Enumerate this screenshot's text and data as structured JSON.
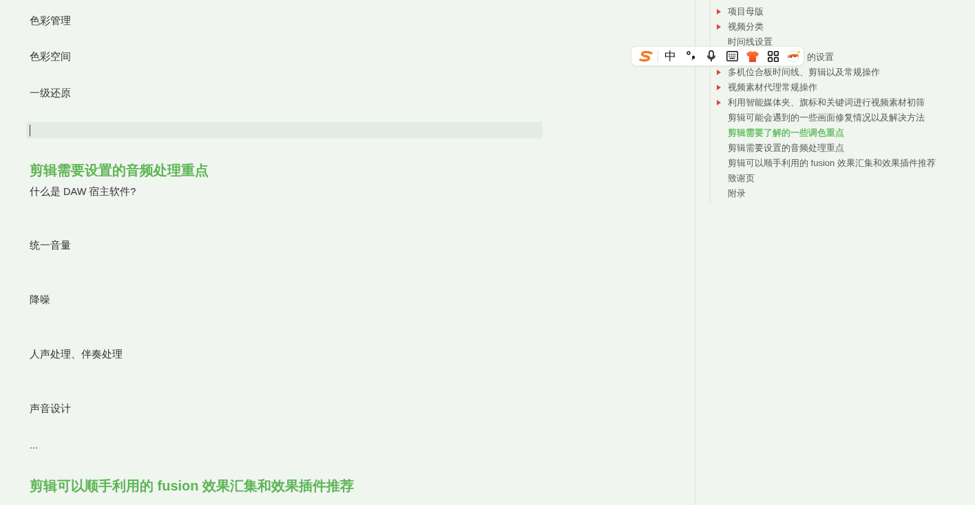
{
  "document": {
    "blocks": [
      {
        "kind": "paragraph",
        "text": "色彩管理"
      },
      {
        "kind": "paragraph",
        "text": "色彩空间"
      },
      {
        "kind": "paragraph",
        "text": "一级还原"
      },
      {
        "kind": "cursor_line"
      },
      {
        "kind": "heading",
        "text": "剪辑需要设置的音频处理重点"
      },
      {
        "kind": "paragraph",
        "text": "什么是 DAW 宿主软件?"
      },
      {
        "kind": "paragraph",
        "text": "统一音量"
      },
      {
        "kind": "paragraph",
        "text": "降噪"
      },
      {
        "kind": "paragraph",
        "text": "人声处理、伴奏处理"
      },
      {
        "kind": "paragraph",
        "text": "声音设计"
      },
      {
        "kind": "paragraph",
        "text": "..."
      },
      {
        "kind": "heading",
        "text": "剪辑可以顺手利用的 fusion 效果汇集和效果插件推荐"
      }
    ]
  },
  "outline": {
    "items": [
      {
        "kind": "entry",
        "text": "项目母版",
        "expandable": true,
        "selected": false
      },
      {
        "kind": "entry",
        "text": "视频分类",
        "expandable": true,
        "selected": false
      },
      {
        "kind": "entry",
        "text": "时间线设置",
        "expandable": false,
        "selected": false
      },
      {
        "kind": "covered",
        "text": "的设置",
        "selected": false
      },
      {
        "kind": "entry",
        "text": "多机位合板时间线、剪辑以及常规操作",
        "expandable": true,
        "selected": false
      },
      {
        "kind": "entry",
        "text": "视频素材代理常规操作",
        "expandable": true,
        "selected": false
      },
      {
        "kind": "entry",
        "text": "利用智能媒体夹、旗标和关键词进行视频素材初筛",
        "expandable": true,
        "selected": false
      },
      {
        "kind": "entry",
        "text": "剪辑可能会遇到的一些画面修复情况以及解决方法",
        "expandable": false,
        "selected": false
      },
      {
        "kind": "entry",
        "text": "剪辑需要了解的一些调色重点",
        "expandable": false,
        "selected": true
      },
      {
        "kind": "entry",
        "text": "剪辑需要设置的音频处理重点",
        "expandable": false,
        "selected": false
      },
      {
        "kind": "entry",
        "text": "剪辑可以顺手利用的 fusion 效果汇集和效果插件推荐",
        "expandable": false,
        "selected": false
      },
      {
        "kind": "entry",
        "text": "致谢页",
        "expandable": false,
        "selected": false
      },
      {
        "kind": "entry",
        "text": "附录",
        "expandable": false,
        "selected": false
      }
    ]
  },
  "ime_toolbar": {
    "mode": "中"
  }
}
